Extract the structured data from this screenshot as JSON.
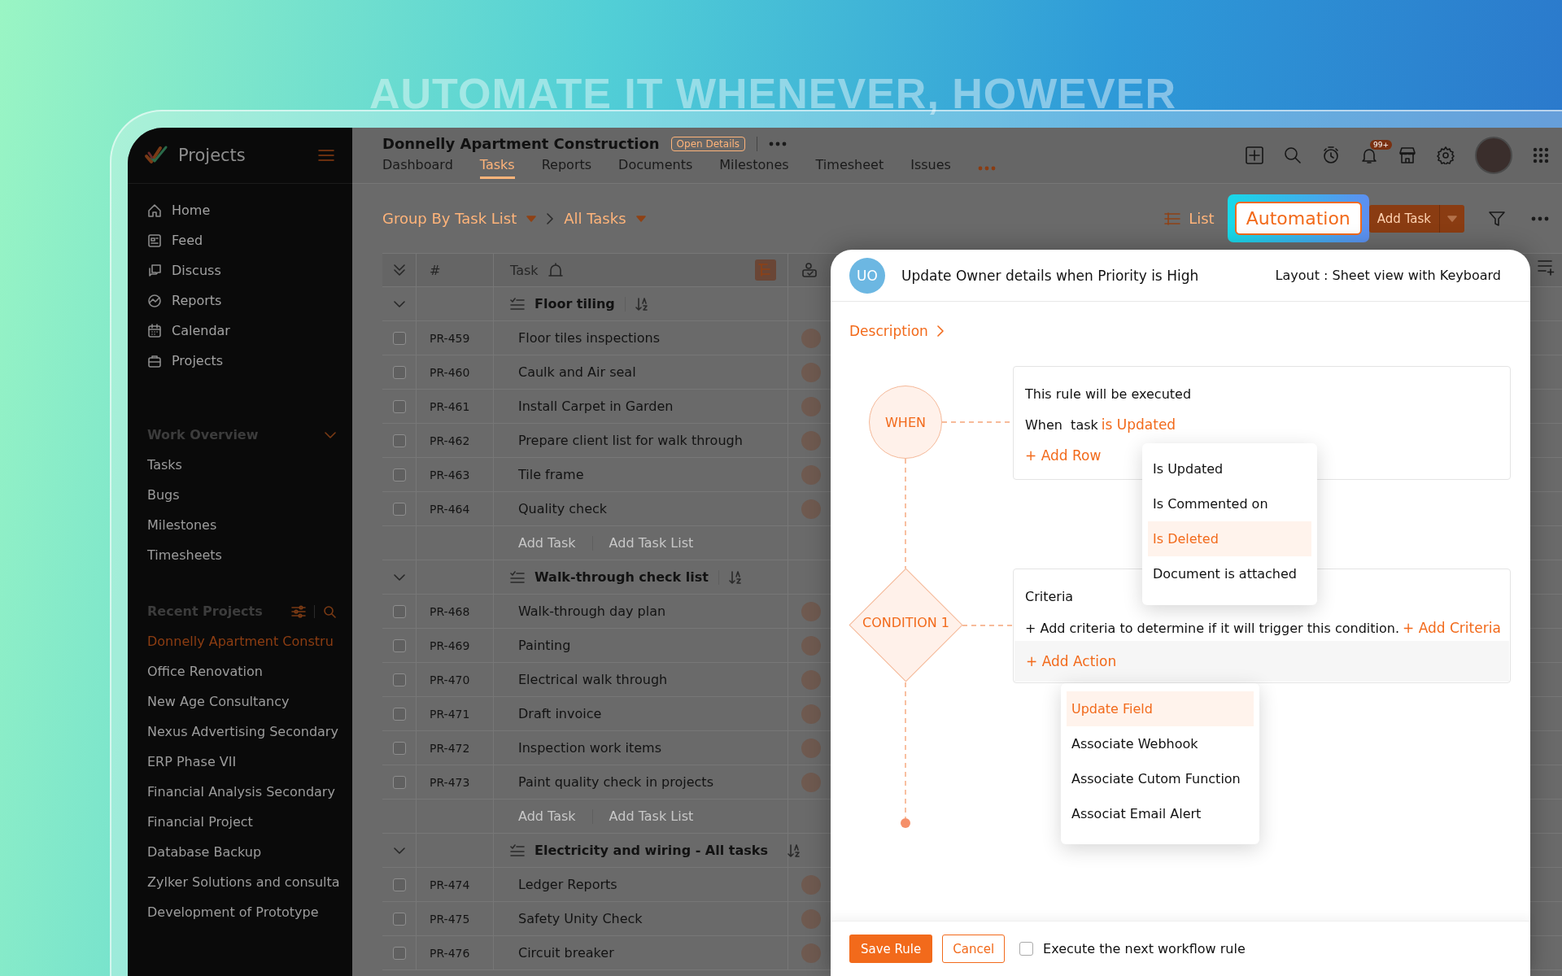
{
  "headline": "AUTOMATE IT WHENEVER, HOWEVER",
  "sidebar": {
    "app_name": "Projects",
    "nav": [
      {
        "label": "Home"
      },
      {
        "label": "Feed"
      },
      {
        "label": "Discuss"
      },
      {
        "label": "Reports"
      },
      {
        "label": "Calendar"
      },
      {
        "label": "Projects"
      }
    ],
    "work_overview": {
      "title": "Work Overview",
      "items": [
        "Tasks",
        "Bugs",
        "Milestones",
        "Timesheets"
      ]
    },
    "recent_projects": {
      "title": "Recent Projects",
      "items": [
        {
          "label": "Donnelly Apartment Constru",
          "selected": true
        },
        {
          "label": "Office Renovation",
          "selected": false
        },
        {
          "label": "New Age Consultancy",
          "selected": false
        },
        {
          "label": "Nexus Advertising Secondary",
          "selected": false
        },
        {
          "label": "ERP Phase VII",
          "selected": false
        },
        {
          "label": "Financial Analysis Secondary",
          "selected": false
        },
        {
          "label": "Financial  Project",
          "selected": false
        },
        {
          "label": "Database Backup",
          "selected": false
        },
        {
          "label": "Zylker Solutions and consulta",
          "selected": false
        },
        {
          "label": "Development of Prototype",
          "selected": false
        }
      ]
    }
  },
  "header": {
    "project_title": "Donnelly Apartment Construction",
    "open_details": "Open Details",
    "notification_badge": "99+",
    "tabs": [
      {
        "label": "Dashboard",
        "selected": false
      },
      {
        "label": "Tasks",
        "selected": true
      },
      {
        "label": "Reports",
        "selected": false
      },
      {
        "label": "Documents",
        "selected": false
      },
      {
        "label": "Milestones",
        "selected": false
      },
      {
        "label": "Timesheet",
        "selected": false
      },
      {
        "label": "Issues",
        "selected": false
      }
    ]
  },
  "toolbar": {
    "group_by": "Group By Task List",
    "view": "All Tasks",
    "list": "List",
    "automation": "Automation",
    "add_task": "Add Task"
  },
  "table": {
    "columns": [
      "#",
      "Task"
    ],
    "groups": [
      {
        "name": "Floor tiling",
        "add_task": "Add Task",
        "add_task_list": "Add Task List",
        "tasks": [
          {
            "id": "PR-459",
            "title": "Floor tiles inspections",
            "checked": false
          },
          {
            "id": "PR-460",
            "title": "Caulk and Air seal",
            "checked": false
          },
          {
            "id": "PR-461",
            "title": "Install Carpet in Garden",
            "checked": false
          },
          {
            "id": "PR-462",
            "title": "Prepare client list for walk through",
            "checked": false
          },
          {
            "id": "PR-463",
            "title": "Tile frame",
            "checked": false
          },
          {
            "id": "PR-464",
            "title": "Quality check",
            "checked": false
          }
        ]
      },
      {
        "name": "Walk-through check list",
        "add_task": "Add Task",
        "add_task_list": "Add Task List",
        "tasks": [
          {
            "id": "PR-468",
            "title": "Walk-through day plan",
            "checked": false
          },
          {
            "id": "PR-469",
            "title": "Painting",
            "checked": false
          },
          {
            "id": "PR-470",
            "title": "Electrical walk through",
            "checked": false
          },
          {
            "id": "PR-471",
            "title": "Draft invoice",
            "checked": false
          },
          {
            "id": "PR-472",
            "title": "Inspection work items",
            "checked": false
          },
          {
            "id": "PR-473",
            "title": "Paint quality check in projects",
            "checked": false
          }
        ]
      },
      {
        "name": "Electricity and wiring - All tasks",
        "tasks": [
          {
            "id": "PR-474",
            "title": "Ledger Reports",
            "checked": false
          },
          {
            "id": "PR-475",
            "title": "Safety Unity Check",
            "checked": false
          },
          {
            "id": "PR-476",
            "title": "Circuit breaker",
            "checked": false
          }
        ]
      }
    ]
  },
  "rule": {
    "avatar": "UO",
    "title": "Update Owner details when Priority is High",
    "layout": "Layout : Sheet view with Keyboard",
    "description": "Description",
    "when": {
      "node": "WHEN",
      "intro": "This rule will be executed",
      "prefix": "When  task",
      "event": "is Updated",
      "add_row": "+ Add Row"
    },
    "event_menu": [
      {
        "label": "Is Updated",
        "selected": false
      },
      {
        "label": "Is Commented on",
        "selected": false
      },
      {
        "label": "Is Deleted",
        "selected": true
      },
      {
        "label": "Document is attached",
        "selected": false
      }
    ],
    "condition": {
      "node": "CONDITION 1",
      "title": "Criteria",
      "text": "+ Add criteria to determine if it will trigger this condition.",
      "add_criteria": "+ Add Criteria",
      "add_action": "+ Add Action"
    },
    "action_menu": [
      {
        "label": "Update Field",
        "selected": true
      },
      {
        "label": "Associate Webhook",
        "selected": false
      },
      {
        "label": "Associate Cutom Function",
        "selected": false
      },
      {
        "label": "Associat Email Alert",
        "selected": false
      }
    ],
    "footer": {
      "save": "Save Rule",
      "cancel": "Cancel",
      "next_rule": {
        "label": "Execute the next workflow rule",
        "checked": false
      }
    }
  }
}
